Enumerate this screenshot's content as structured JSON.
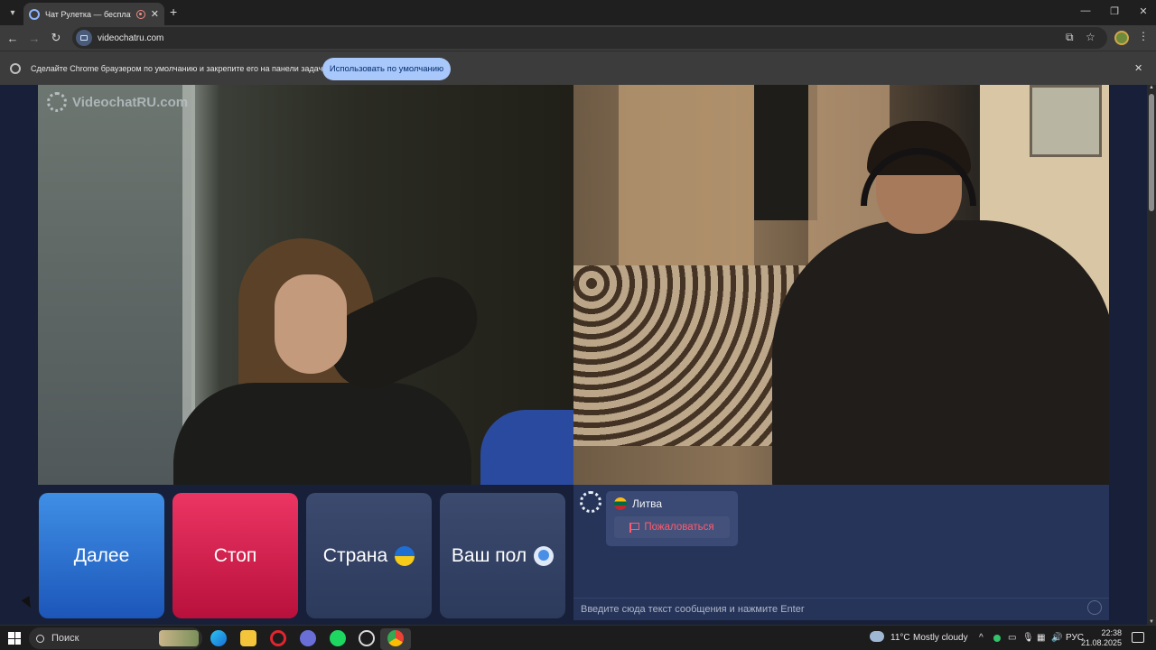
{
  "browser": {
    "tab_title": "Чат Рулетка — бесплатны",
    "url": "videochatru.com",
    "infobar_text": "Сделайте Chrome браузером по умолчанию и закрепите его на панели задач.",
    "infobar_button": "Использовать по умолчанию"
  },
  "site": {
    "logo_text": "VideochatRU.com",
    "buttons": {
      "next": "Далее",
      "stop": "Стоп",
      "country": "Страна",
      "gender": "Ваш пол"
    },
    "chat": {
      "partner_country": "Литва",
      "report_label": "Пожаловаться",
      "input_placeholder": "Введите сюда текст сообщения и нажмите Enter"
    }
  },
  "taskbar": {
    "search_label": "Поиск",
    "weather": "11°C",
    "weather_desc": "Mostly cloudy",
    "language": "РУС",
    "time": "22:38",
    "date": "21.08.2025"
  }
}
